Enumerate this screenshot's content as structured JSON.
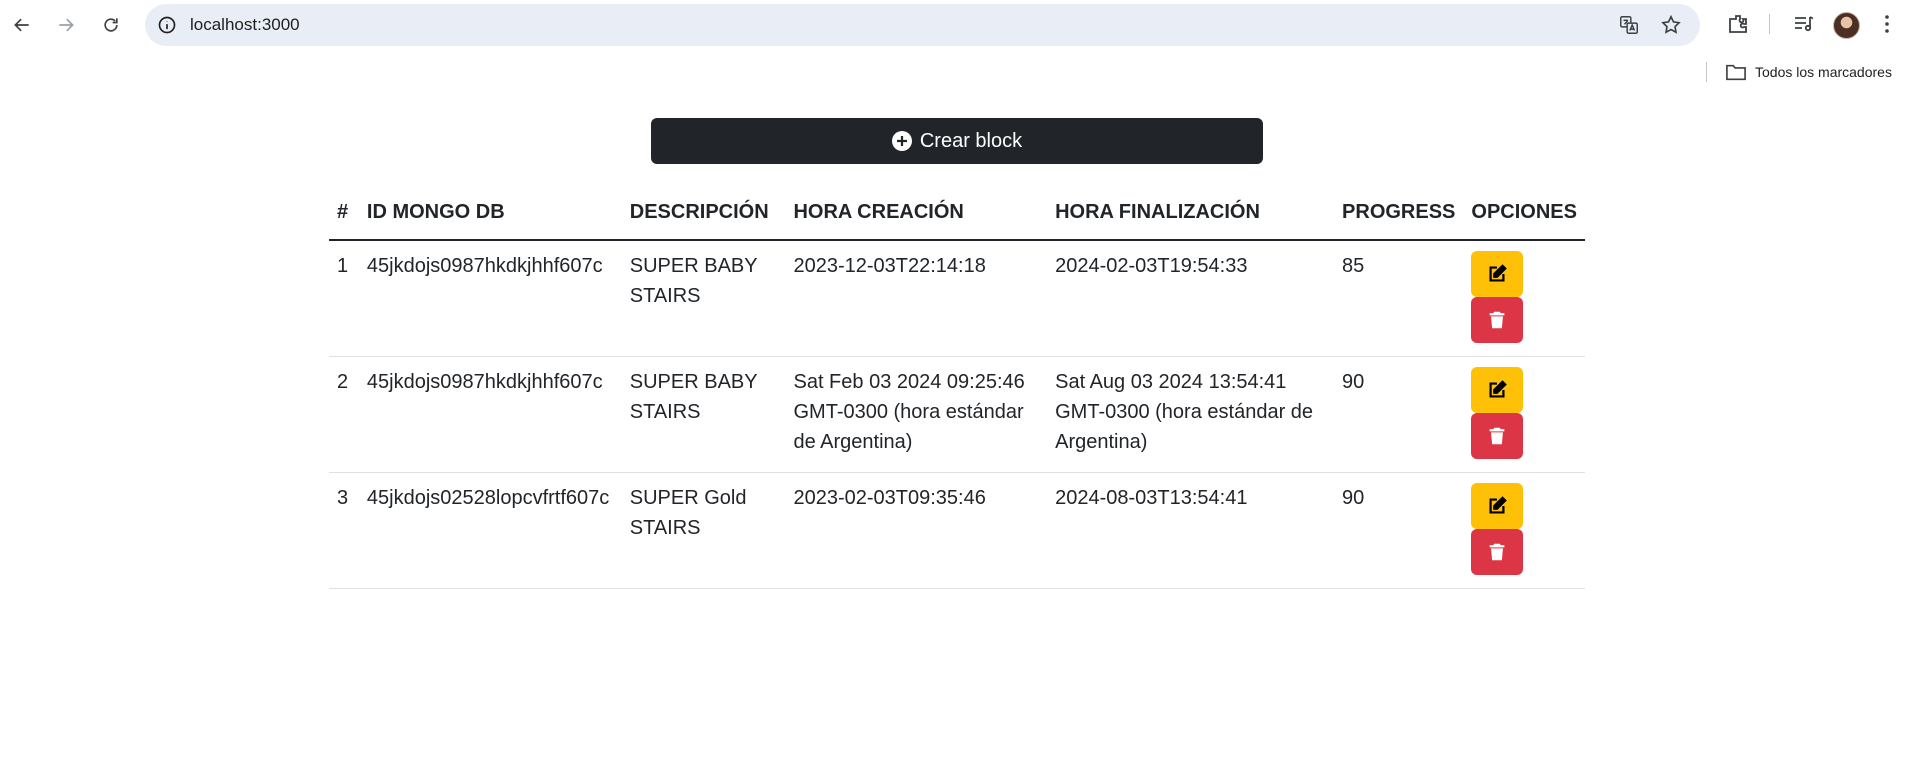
{
  "browser": {
    "url": "localhost:3000",
    "bookmarks_folder_label": "Todos los marcadores"
  },
  "page": {
    "create_button_label": "Crear block"
  },
  "table": {
    "headers": {
      "num": "#",
      "id": "ID MONGO DB",
      "description": "DESCRIPCIÓN",
      "creation": "HORA CREACIÓN",
      "finalization": "HORA FINALIZACIÓN",
      "progress": "PROGRESS",
      "options": "OPCIONES"
    },
    "rows": [
      {
        "num": "1",
        "id": "45jkdojs0987hkdkjhhf607c",
        "description": "SUPER BABY STAIRS",
        "creation": "2023-12-03T22:14:18",
        "finalization": "2024-02-03T19:54:33",
        "progress": "85"
      },
      {
        "num": "2",
        "id": "45jkdojs0987hkdkjhhf607c",
        "description": "SUPER BABY STAIRS",
        "creation": "Sat Feb 03 2024 09:25:46 GMT-0300 (hora estándar de Argentina)",
        "finalization": "Sat Aug 03 2024 13:54:41 GMT-0300 (hora estándar de Argentina)",
        "progress": "90"
      },
      {
        "num": "3",
        "id": "45jkdojs02528lopcvfrtf607c",
        "description": "SUPER Gold STAIRS",
        "creation": "2023-02-03T09:35:46",
        "finalization": "2024-08-03T13:54:41",
        "progress": "90"
      }
    ]
  },
  "colors": {
    "dark_button": "#212529",
    "edit_button": "#ffc107",
    "delete_button": "#dc3545"
  }
}
